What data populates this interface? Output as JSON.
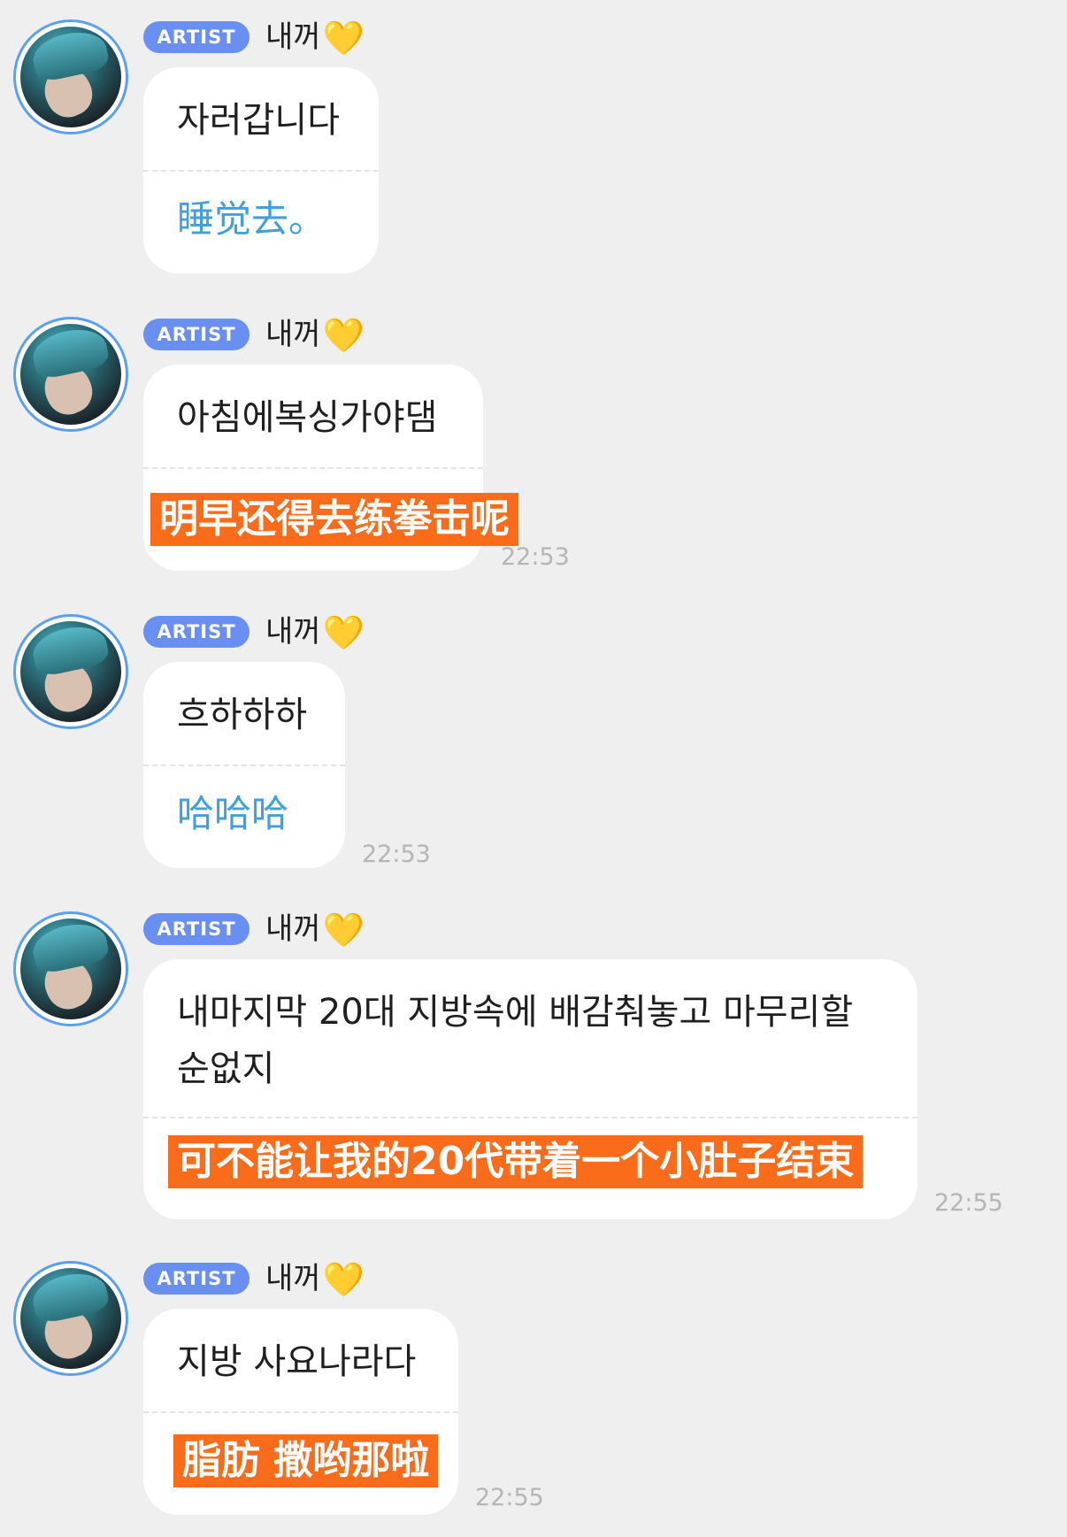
{
  "badge": "ARTIST",
  "artist": "내꺼",
  "heart": "💛",
  "messages": [
    {
      "korean": "자러갑니다",
      "translation": "睡觉去。",
      "time": ""
    },
    {
      "korean": "아침에복싱가야댐",
      "translation": "明早还得去练拳击呢",
      "time": "22:53"
    },
    {
      "korean": "흐하하하",
      "translation": "哈哈哈",
      "time": "22:53"
    },
    {
      "korean": "내마지막 20대 지방속에 배감춰놓고 마무리할 순없지",
      "translation": "可不能让我的20代带着一个小肚子结束",
      "time": "22:55"
    },
    {
      "korean": "지방 사요나라다",
      "translation": "脂肪 撒哟那啦",
      "time": "22:55"
    }
  ]
}
